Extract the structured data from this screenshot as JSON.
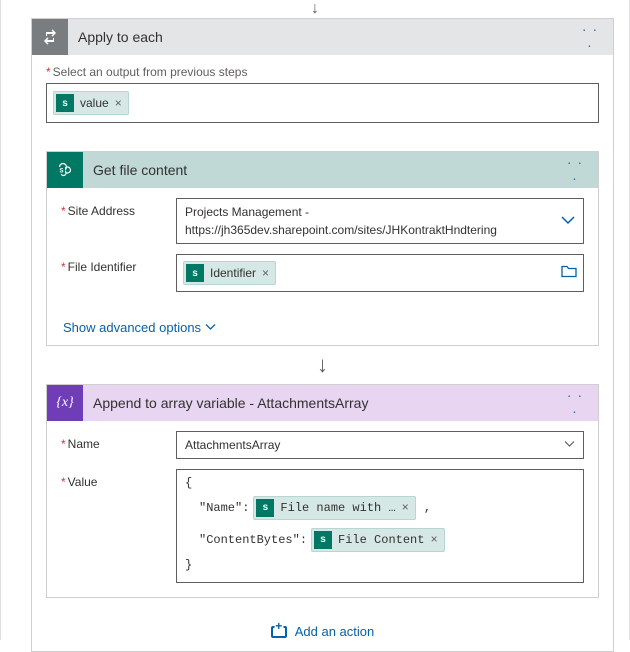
{
  "applyToEach": {
    "title": "Apply to each",
    "selectLabel": "Select an output from previous steps",
    "token": "value"
  },
  "getFileContent": {
    "title": "Get file content",
    "siteLabel": "Site Address",
    "siteValue": "Projects Management -\nhttps://jh365dev.sharepoint.com/sites/JHKontraktHndtering",
    "fileIdLabel": "File Identifier",
    "fileIdToken": "Identifier",
    "advancedLink": "Show advanced options"
  },
  "appendArray": {
    "title": "Append to array variable - AttachmentsArray",
    "nameLabel": "Name",
    "nameValue": "AttachmentsArray",
    "valueLabel": "Value",
    "json": {
      "key1": "\"Name\":",
      "token1": "File name with …",
      "key2": "\"ContentBytes\":",
      "token2": "File Content"
    }
  },
  "addAction": "Add an action"
}
